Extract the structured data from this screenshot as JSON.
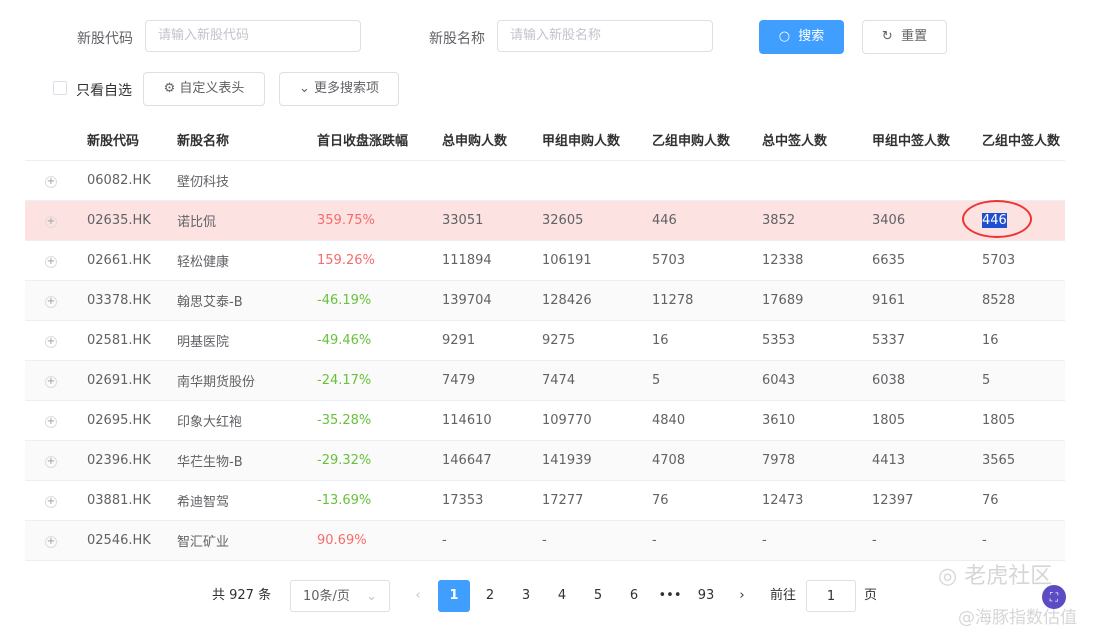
{
  "filters": {
    "code_label": "新股代码",
    "code_placeholder": "请输入新股代码",
    "name_label": "新股名称",
    "name_placeholder": "请输入新股名称",
    "search": "搜索",
    "reset": "重置",
    "watchlist_only": "只看自选",
    "custom_header": "自定义表头",
    "more_filters": "更多搜索项"
  },
  "table": {
    "headers": [
      "新股代码",
      "新股名称",
      "首日收盘涨跌幅",
      "总申购人数",
      "甲组申购人数",
      "乙组申购人数",
      "总中签人数",
      "甲组中签人数",
      "乙组中签人数"
    ],
    "rows": [
      [
        "06082.HK",
        "壁仞科技",
        "",
        "",
        "",
        "",
        "",
        "",
        ""
      ],
      [
        "02635.HK",
        "诺比侃",
        "359.75%",
        "33051",
        "32605",
        "446",
        "3852",
        "3406",
        "446"
      ],
      [
        "02661.HK",
        "轻松健康",
        "159.26%",
        "111894",
        "106191",
        "5703",
        "12338",
        "6635",
        "5703"
      ],
      [
        "03378.HK",
        "翰思艾泰-B",
        "-46.19%",
        "139704",
        "128426",
        "11278",
        "17689",
        "9161",
        "8528"
      ],
      [
        "02581.HK",
        "明基医院",
        "-49.46%",
        "9291",
        "9275",
        "16",
        "5353",
        "5337",
        "16"
      ],
      [
        "02691.HK",
        "南华期货股份",
        "-24.17%",
        "7479",
        "7474",
        "5",
        "6043",
        "6038",
        "5"
      ],
      [
        "02695.HK",
        "印象大红袍",
        "-35.28%",
        "114610",
        "109770",
        "4840",
        "3610",
        "1805",
        "1805"
      ],
      [
        "02396.HK",
        "华芢生物-B",
        "-29.32%",
        "146647",
        "141939",
        "4708",
        "7978",
        "4413",
        "3565"
      ],
      [
        "03881.HK",
        "希迪智驾",
        "-13.69%",
        "17353",
        "17277",
        "76",
        "12473",
        "12397",
        "76"
      ],
      [
        "02546.HK",
        "智汇矿业",
        "90.69%",
        "-",
        "-",
        "-",
        "-",
        "-",
        "-"
      ]
    ]
  },
  "pagination": {
    "total": "共 927 条",
    "page_size": "10条/页",
    "pages": [
      "1",
      "2",
      "3",
      "4",
      "5",
      "6",
      "•••",
      "93"
    ],
    "goto_label": "前往",
    "goto_value": "1",
    "page_suffix": "页"
  },
  "watermark": {
    "line1": "老虎社区",
    "line2": "@海豚指数估值"
  }
}
